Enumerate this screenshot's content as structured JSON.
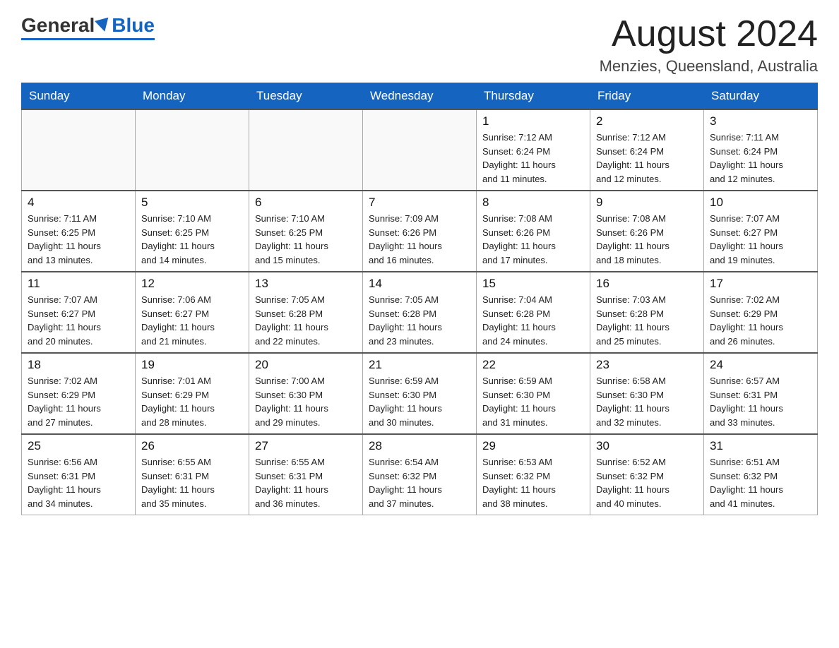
{
  "header": {
    "logo_general": "General",
    "logo_blue": "Blue",
    "month_title": "August 2024",
    "location": "Menzies, Queensland, Australia"
  },
  "days_of_week": [
    "Sunday",
    "Monday",
    "Tuesday",
    "Wednesday",
    "Thursday",
    "Friday",
    "Saturday"
  ],
  "weeks": [
    [
      {
        "day": "",
        "info": ""
      },
      {
        "day": "",
        "info": ""
      },
      {
        "day": "",
        "info": ""
      },
      {
        "day": "",
        "info": ""
      },
      {
        "day": "1",
        "info": "Sunrise: 7:12 AM\nSunset: 6:24 PM\nDaylight: 11 hours\nand 11 minutes."
      },
      {
        "day": "2",
        "info": "Sunrise: 7:12 AM\nSunset: 6:24 PM\nDaylight: 11 hours\nand 12 minutes."
      },
      {
        "day": "3",
        "info": "Sunrise: 7:11 AM\nSunset: 6:24 PM\nDaylight: 11 hours\nand 12 minutes."
      }
    ],
    [
      {
        "day": "4",
        "info": "Sunrise: 7:11 AM\nSunset: 6:25 PM\nDaylight: 11 hours\nand 13 minutes."
      },
      {
        "day": "5",
        "info": "Sunrise: 7:10 AM\nSunset: 6:25 PM\nDaylight: 11 hours\nand 14 minutes."
      },
      {
        "day": "6",
        "info": "Sunrise: 7:10 AM\nSunset: 6:25 PM\nDaylight: 11 hours\nand 15 minutes."
      },
      {
        "day": "7",
        "info": "Sunrise: 7:09 AM\nSunset: 6:26 PM\nDaylight: 11 hours\nand 16 minutes."
      },
      {
        "day": "8",
        "info": "Sunrise: 7:08 AM\nSunset: 6:26 PM\nDaylight: 11 hours\nand 17 minutes."
      },
      {
        "day": "9",
        "info": "Sunrise: 7:08 AM\nSunset: 6:26 PM\nDaylight: 11 hours\nand 18 minutes."
      },
      {
        "day": "10",
        "info": "Sunrise: 7:07 AM\nSunset: 6:27 PM\nDaylight: 11 hours\nand 19 minutes."
      }
    ],
    [
      {
        "day": "11",
        "info": "Sunrise: 7:07 AM\nSunset: 6:27 PM\nDaylight: 11 hours\nand 20 minutes."
      },
      {
        "day": "12",
        "info": "Sunrise: 7:06 AM\nSunset: 6:27 PM\nDaylight: 11 hours\nand 21 minutes."
      },
      {
        "day": "13",
        "info": "Sunrise: 7:05 AM\nSunset: 6:28 PM\nDaylight: 11 hours\nand 22 minutes."
      },
      {
        "day": "14",
        "info": "Sunrise: 7:05 AM\nSunset: 6:28 PM\nDaylight: 11 hours\nand 23 minutes."
      },
      {
        "day": "15",
        "info": "Sunrise: 7:04 AM\nSunset: 6:28 PM\nDaylight: 11 hours\nand 24 minutes."
      },
      {
        "day": "16",
        "info": "Sunrise: 7:03 AM\nSunset: 6:28 PM\nDaylight: 11 hours\nand 25 minutes."
      },
      {
        "day": "17",
        "info": "Sunrise: 7:02 AM\nSunset: 6:29 PM\nDaylight: 11 hours\nand 26 minutes."
      }
    ],
    [
      {
        "day": "18",
        "info": "Sunrise: 7:02 AM\nSunset: 6:29 PM\nDaylight: 11 hours\nand 27 minutes."
      },
      {
        "day": "19",
        "info": "Sunrise: 7:01 AM\nSunset: 6:29 PM\nDaylight: 11 hours\nand 28 minutes."
      },
      {
        "day": "20",
        "info": "Sunrise: 7:00 AM\nSunset: 6:30 PM\nDaylight: 11 hours\nand 29 minutes."
      },
      {
        "day": "21",
        "info": "Sunrise: 6:59 AM\nSunset: 6:30 PM\nDaylight: 11 hours\nand 30 minutes."
      },
      {
        "day": "22",
        "info": "Sunrise: 6:59 AM\nSunset: 6:30 PM\nDaylight: 11 hours\nand 31 minutes."
      },
      {
        "day": "23",
        "info": "Sunrise: 6:58 AM\nSunset: 6:30 PM\nDaylight: 11 hours\nand 32 minutes."
      },
      {
        "day": "24",
        "info": "Sunrise: 6:57 AM\nSunset: 6:31 PM\nDaylight: 11 hours\nand 33 minutes."
      }
    ],
    [
      {
        "day": "25",
        "info": "Sunrise: 6:56 AM\nSunset: 6:31 PM\nDaylight: 11 hours\nand 34 minutes."
      },
      {
        "day": "26",
        "info": "Sunrise: 6:55 AM\nSunset: 6:31 PM\nDaylight: 11 hours\nand 35 minutes."
      },
      {
        "day": "27",
        "info": "Sunrise: 6:55 AM\nSunset: 6:31 PM\nDaylight: 11 hours\nand 36 minutes."
      },
      {
        "day": "28",
        "info": "Sunrise: 6:54 AM\nSunset: 6:32 PM\nDaylight: 11 hours\nand 37 minutes."
      },
      {
        "day": "29",
        "info": "Sunrise: 6:53 AM\nSunset: 6:32 PM\nDaylight: 11 hours\nand 38 minutes."
      },
      {
        "day": "30",
        "info": "Sunrise: 6:52 AM\nSunset: 6:32 PM\nDaylight: 11 hours\nand 40 minutes."
      },
      {
        "day": "31",
        "info": "Sunrise: 6:51 AM\nSunset: 6:32 PM\nDaylight: 11 hours\nand 41 minutes."
      }
    ]
  ]
}
